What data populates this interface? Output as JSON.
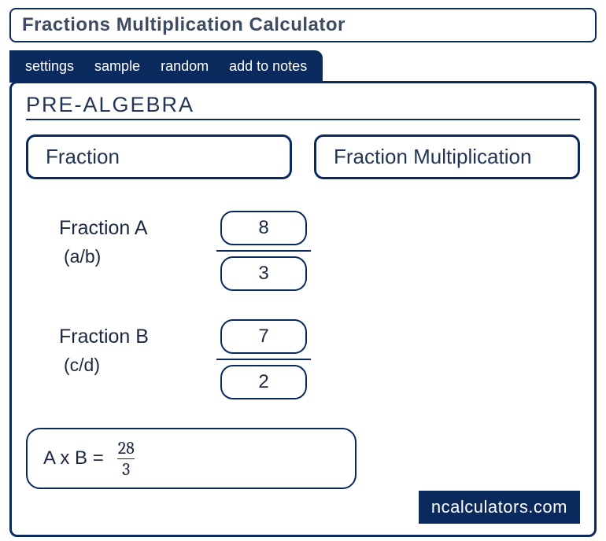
{
  "title": "Fractions Multiplication Calculator",
  "tabs": {
    "t0": "settings",
    "t1": "sample",
    "t2": "random",
    "t3": "add to notes"
  },
  "section": "PRE-ALGEBRA",
  "pills": {
    "p0": "Fraction",
    "p1": "Fraction Multiplication"
  },
  "fractionA": {
    "label": "Fraction A",
    "sub": "(a/b)",
    "num": "8",
    "den": "3"
  },
  "fractionB": {
    "label": "Fraction B",
    "sub": "(c/d)",
    "num": "7",
    "den": "2"
  },
  "result": {
    "prefix": "A x B  =",
    "num": "28",
    "den": "3"
  },
  "brand": "ncalculators.com"
}
